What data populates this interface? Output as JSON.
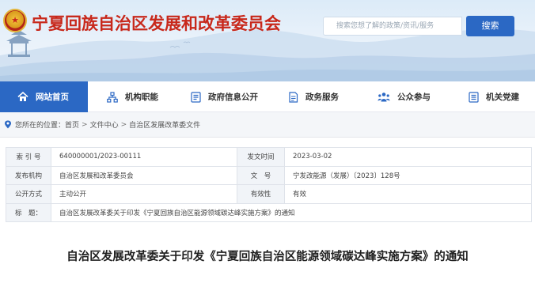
{
  "header": {
    "site_title": "宁夏回族自治区发展和改革委员会",
    "search_placeholder": "搜索您想了解的政策/资讯/服务",
    "search_button": "搜索"
  },
  "nav": {
    "items": [
      {
        "label": "网站首页",
        "icon": "home-icon",
        "active": true
      },
      {
        "label": "机构职能",
        "icon": "org-chart-icon",
        "active": false
      },
      {
        "label": "政府信息公开",
        "icon": "document-list-icon",
        "active": false
      },
      {
        "label": "政务服务",
        "icon": "service-doc-icon",
        "active": false
      },
      {
        "label": "公众参与",
        "icon": "people-icon",
        "active": false
      },
      {
        "label": "机关党建",
        "icon": "party-doc-icon",
        "active": false
      }
    ]
  },
  "breadcrumb": {
    "prefix": "您所在的位置：",
    "items": [
      "首页",
      "文件中心",
      "自治区发展改革委文件"
    ],
    "separator": ">"
  },
  "meta": {
    "index_label": "索 引 号",
    "index_value": "640000001/2023-00111",
    "date_label": "发文时间",
    "date_value": "2023-03-02",
    "org_label": "发布机构",
    "org_value": "自治区发展和改革委员会",
    "docno_label": "文　号",
    "docno_value": "宁发改能源（发展）〔2023〕128号",
    "open_label": "公开方式",
    "open_value": "主动公开",
    "valid_label": "有效性",
    "valid_value": "有效",
    "title_label": "标　题：",
    "title_value": "自治区发展改革委关于印发《宁夏回族自治区能源领域碳达峰实施方案》的通知"
  },
  "headline": "自治区发展改革委关于印发《宁夏回族自治区能源领域碳达峰实施方案》的通知",
  "colors": {
    "title_red": "#c8281b",
    "nav_blue": "#2b68c4",
    "key_cell_bg": "#f1f4f8"
  }
}
